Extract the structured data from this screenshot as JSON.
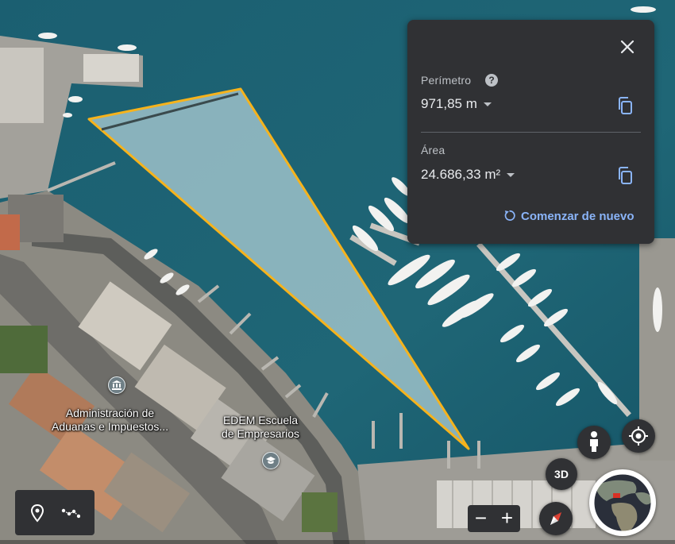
{
  "measure_panel": {
    "perimeter_label": "Perímetro",
    "perimeter_value": "971,85 m",
    "area_label": "Área",
    "area_value": "24.686,33 m²",
    "restart_label": "Comenzar de nuevo",
    "help_glyph": "?"
  },
  "map_labels": {
    "customs_line1": "Administración de",
    "customs_line2": "Aduanas e Impuestos...",
    "edem_line1": "EDEM Escuela",
    "edem_line2": "de Empresarios"
  },
  "controls": {
    "view_3d_label": "3D",
    "zoom_out_label": "−",
    "zoom_in_label": "+"
  },
  "icons": [
    "close-icon",
    "help-icon",
    "copy-icon",
    "restart-icon",
    "pegman-icon",
    "my-location-icon",
    "compass-icon",
    "globe-icon",
    "place-pin-icon",
    "measure-path-icon",
    "bank-icon",
    "school-icon"
  ],
  "colors": {
    "measure_outline": "#f6b31c",
    "panel_bg": "#303134",
    "link": "#8ab4f8",
    "water": "#1e5a6a"
  }
}
